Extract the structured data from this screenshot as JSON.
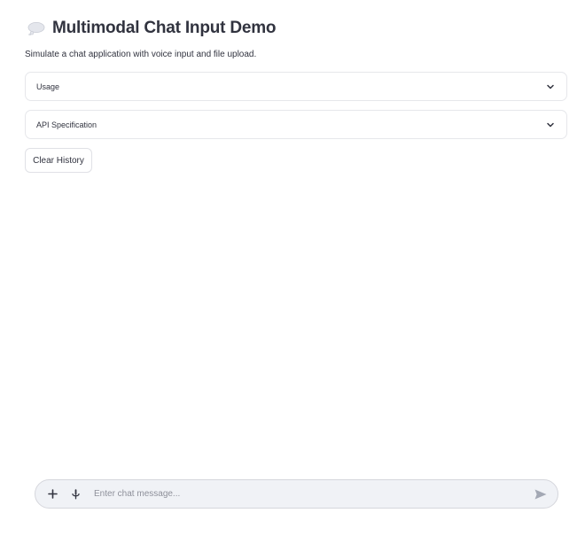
{
  "header": {
    "title_icon": "thought-balloon-icon",
    "title": "Multimodal Chat Input Demo",
    "subtitle": "Simulate a chat application with voice input and file upload."
  },
  "expanders": [
    {
      "label": "Usage",
      "icon": "chevron-down-icon",
      "expanded": false
    },
    {
      "label": "API Specification",
      "icon": "chevron-down-icon",
      "expanded": false
    }
  ],
  "actions": {
    "clear_history_label": "Clear History"
  },
  "chat_input": {
    "placeholder": "Enter chat message...",
    "value": "",
    "add_icon": "plus-icon",
    "mic_icon": "microphone-icon",
    "send_icon": "send-icon"
  },
  "colors": {
    "text": "#31333f",
    "border": "#e6e7eb",
    "chat_bar_bg": "#f0f2f6",
    "placeholder": "#8e909a",
    "send_icon": "#a3a8b4"
  }
}
